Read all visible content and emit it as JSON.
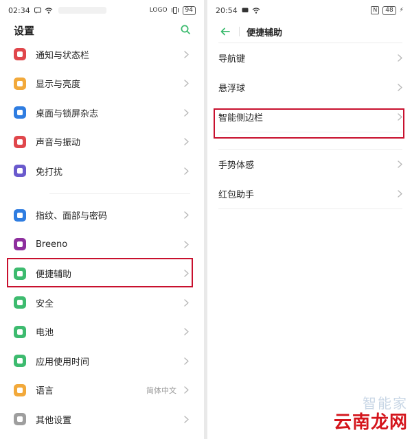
{
  "left": {
    "status": {
      "time": "02:34",
      "battery": "94",
      "logo_text": "LOGO"
    },
    "title": "设置",
    "groups": [
      [
        {
          "label": "通知与状态栏",
          "icon": "notification-icon",
          "color": "#e0474c"
        },
        {
          "label": "显示与亮度",
          "icon": "brightness-icon",
          "color": "#f2a93b"
        },
        {
          "label": "桌面与锁屏杂志",
          "icon": "wallpaper-icon",
          "color": "#2f7de1"
        },
        {
          "label": "声音与振动",
          "icon": "sound-icon",
          "color": "#e0474c"
        },
        {
          "label": "免打扰",
          "icon": "moon-icon",
          "color": "#6a5acd"
        }
      ],
      [
        {
          "label": "指纹、面部与密码",
          "icon": "fingerprint-icon",
          "color": "#2f7de1"
        },
        {
          "label": "Breeno",
          "icon": "breeno-icon",
          "color": "#8e2f9e"
        },
        {
          "label": "便捷辅助",
          "icon": "assist-icon",
          "color": "#3dbb6f"
        },
        {
          "label": "安全",
          "icon": "shield-icon",
          "color": "#3dbb6f"
        },
        {
          "label": "电池",
          "icon": "battery-icon",
          "color": "#3dbb6f"
        },
        {
          "label": "应用使用时间",
          "icon": "app-time-icon",
          "color": "#3dbb6f"
        },
        {
          "label": "语言",
          "icon": "language-icon",
          "color": "#f2a93b",
          "value": "简体中文"
        },
        {
          "label": "其他设置",
          "icon": "other-settings-icon",
          "color": "#9e9e9e"
        }
      ]
    ]
  },
  "right": {
    "status": {
      "time": "20:54",
      "battery": "48",
      "nfc": "N"
    },
    "title": "便捷辅助",
    "groups": [
      [
        {
          "label": "导航键"
        },
        {
          "label": "悬浮球"
        },
        {
          "label": "智能侧边栏"
        }
      ],
      [
        {
          "label": "手势体感"
        },
        {
          "label": "红包助手"
        }
      ]
    ]
  },
  "watermark": {
    "faint": "智能家",
    "brand": "云南龙网"
  },
  "colors": {
    "accent": "#3dbb6f",
    "highlight": "#c8102e"
  }
}
